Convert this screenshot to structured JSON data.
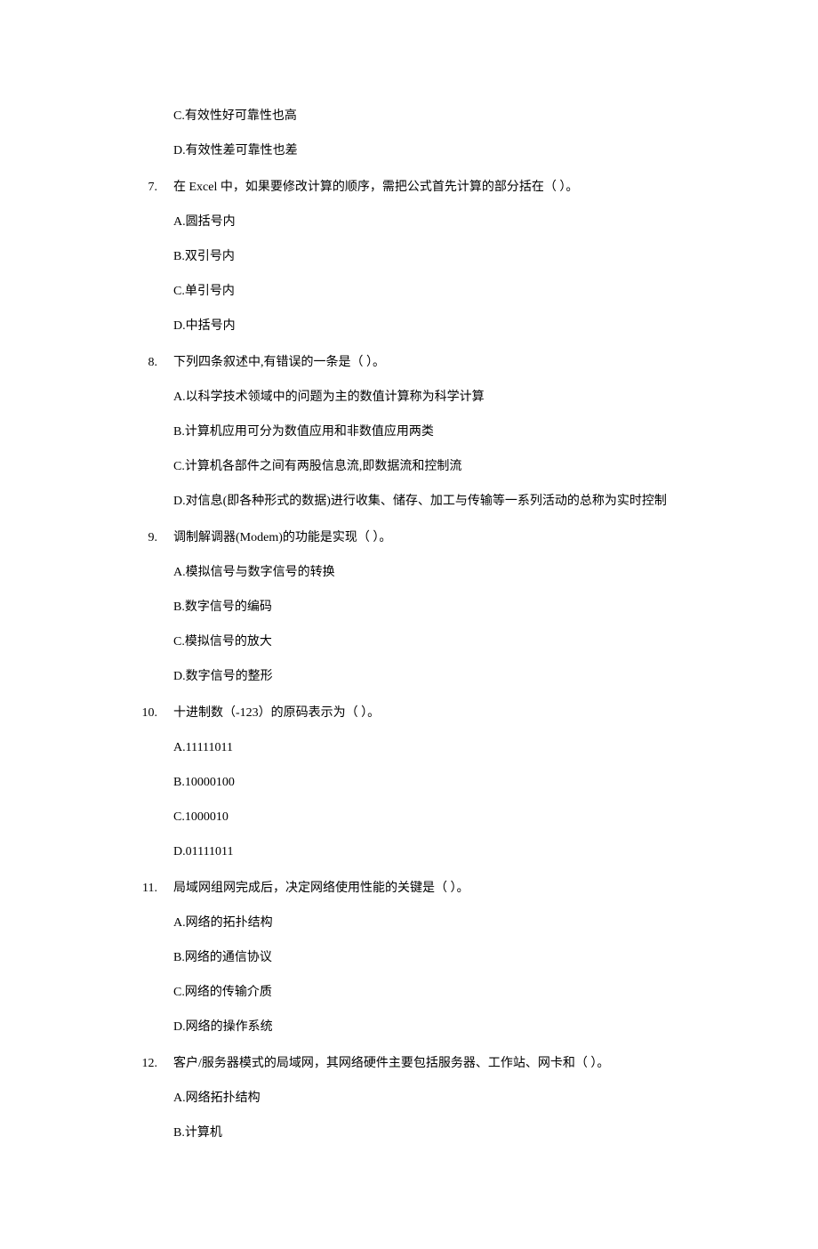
{
  "orphan_top": {
    "options": [
      "C.有效性好可靠性也高",
      "D.有效性差可靠性也差"
    ]
  },
  "questions": [
    {
      "number": "7.",
      "text": "在 Excel 中，如果要修改计算的顺序，需把公式首先计算的部分括在（ ）。",
      "options": [
        "A.圆括号内",
        "B.双引号内",
        "C.单引号内",
        "D.中括号内"
      ]
    },
    {
      "number": "8.",
      "text": "下列四条叙述中,有错误的一条是（ ）。",
      "options": [
        "A.以科学技术领域中的问题为主的数值计算称为科学计算",
        "B.计算机应用可分为数值应用和非数值应用两类",
        "C.计算机各部件之间有两股信息流,即数据流和控制流",
        "D.对信息(即各种形式的数据)进行收集、储存、加工与传输等一系列活动的总称为实时控制"
      ]
    },
    {
      "number": "9.",
      "text": "调制解调器(Modem)的功能是实现（ ）。",
      "options": [
        "A.模拟信号与数字信号的转换",
        "B.数字信号的编码",
        "C.模拟信号的放大",
        "D.数字信号的整形"
      ]
    },
    {
      "number": "10.",
      "text": "十进制数（-123）的原码表示为（ ）。",
      "options": [
        "A.11111011",
        "B.10000100",
        "C.1000010",
        "D.01111011"
      ]
    },
    {
      "number": "11.",
      "text": "局域网组网完成后，决定网络使用性能的关键是（ ）。",
      "options": [
        "A.网络的拓扑结构",
        "B.网络的通信协议",
        "C.网络的传输介质",
        "D.网络的操作系统"
      ]
    },
    {
      "number": "12.",
      "text": "客户/服务器模式的局域网，其网络硬件主要包括服务器、工作站、网卡和（ ）。",
      "options": [
        "A.网络拓扑结构",
        "B.计算机"
      ]
    }
  ]
}
